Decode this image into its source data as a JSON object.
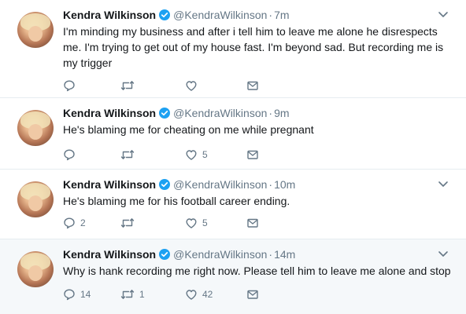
{
  "tweets": [
    {
      "name": "Kendra Wilkinson",
      "handle": "@KendraWilkinson",
      "time": "7m",
      "text": "I'm minding my business and after i tell him to leave me alone he disrespects me. I'm trying to get out of my house fast. I'm beyond sad. But recording me is my trigger",
      "replies": "",
      "retweets": "",
      "likes": ""
    },
    {
      "name": "Kendra Wilkinson",
      "handle": "@KendraWilkinson",
      "time": "9m",
      "text": "He's blaming me for cheating on me while pregnant",
      "replies": "",
      "retweets": "",
      "likes": "5"
    },
    {
      "name": "Kendra Wilkinson",
      "handle": "@KendraWilkinson",
      "time": "10m",
      "text": "He's blaming me for his football career ending.",
      "replies": "2",
      "retweets": "",
      "likes": "5"
    },
    {
      "name": "Kendra Wilkinson",
      "handle": "@KendraWilkinson",
      "time": "14m",
      "text": "Why is hank recording me right now. Please tell him to leave me alone and stop",
      "replies": "14",
      "retweets": "1",
      "likes": "42"
    }
  ],
  "ui": {
    "dot_separator": "·",
    "accent_color": "#1da1f2",
    "icon_color": "#657786"
  },
  "icons": {
    "verified": "verified-badge-icon",
    "caret": "chevron-down-icon",
    "reply": "reply-icon",
    "retweet": "retweet-icon",
    "like": "heart-icon",
    "dm": "envelope-icon"
  }
}
